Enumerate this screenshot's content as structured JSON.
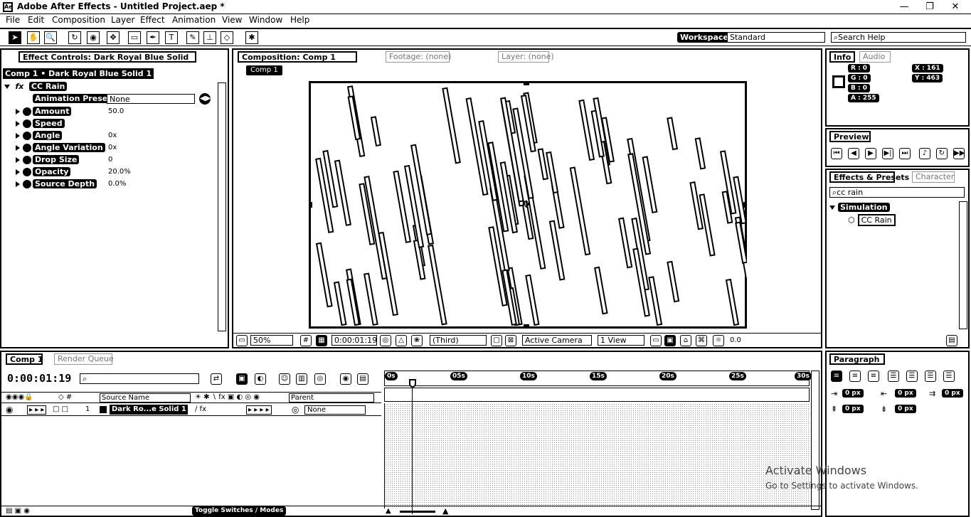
{
  "app": {
    "title": "Adobe After Effects - Untitled Project.aep *",
    "icon_label": "Ae"
  },
  "window_controls": {
    "minimize": "—",
    "maximize": "❐",
    "close": "✕"
  },
  "menu": [
    "File",
    "Edit",
    "Composition",
    "Layer",
    "Effect",
    "Animation",
    "View",
    "Window",
    "Help"
  ],
  "toolbar": {
    "tools": [
      "selection-tool",
      "hand-tool",
      "zoom-tool",
      "rotation-tool",
      "camera-tool",
      "pan-behind-tool",
      "rectangle-mask-tool",
      "pen-tool",
      "text-tool",
      "brush-tool",
      "clone-stamp-tool",
      "eraser-tool",
      "puppet-tool"
    ],
    "workspace_label": "Workspace:",
    "workspace_value": "Standard",
    "search_help_placeholder": "Search Help"
  },
  "effect_controls": {
    "tab_label": "Effect Controls: Dark Royal Blue Solid",
    "layer_path": "Comp 1 • Dark Royal Blue Solid 1",
    "effect_name": "CC Rain",
    "reset_label": "fx",
    "animation_presets_label": "Animation Presets:",
    "animation_presets_value": "None",
    "properties": [
      {
        "name": "Amount",
        "value": "50.0"
      },
      {
        "name": "Speed",
        "value": ""
      },
      {
        "name": "Angle",
        "value": "0x"
      },
      {
        "name": "Angle Variation",
        "value": "0x"
      },
      {
        "name": "Drop Size",
        "value": "0"
      },
      {
        "name": "Opacity",
        "value": "20.0%"
      },
      {
        "name": "Source Depth",
        "value": "0.0%"
      }
    ]
  },
  "composition_panel": {
    "tab_label": "Composition: Comp 1",
    "tab_footage": "Footage: (none)",
    "tab_layer": "Layer: (none)",
    "comp_button": "Comp 1",
    "footer": {
      "zoom": "50%",
      "timecode": "0:00:01:19",
      "resolution": "(Third)",
      "camera": "Active Camera",
      "views": "1 View",
      "exposure": "0.0"
    }
  },
  "info_panel": {
    "tab_label": "Info",
    "tab2_label": "Audio",
    "r": "R : 0",
    "g": "G : 0",
    "b": "B : 0",
    "a": "A : 255",
    "x": "X : 161",
    "y": "Y : 463"
  },
  "preview_panel": {
    "tab_label": "Preview"
  },
  "effects_presets": {
    "tab_label": "Effects & Presets",
    "tab2_label": "Character",
    "search_value": "cc rain",
    "category": "Simulation",
    "item": "CC Rain"
  },
  "timeline": {
    "tab_label": "Comp 1",
    "tab2_label": "Render Queue",
    "timecode": "0:00:01:19",
    "columns": {
      "source_name": "Source Name",
      "parent": "Parent"
    },
    "layer": {
      "number": "1",
      "name": "Dark Ro...e Solid 1",
      "parent": "None"
    },
    "ruler": [
      "0s",
      "05s",
      "10s",
      "15s",
      "20s",
      "25s",
      "30s"
    ],
    "toggle_label": "Toggle Switches / Modes"
  },
  "paragraph_panel": {
    "tab_label": "Paragraph",
    "indents": [
      "0 px",
      "0 px",
      "0 px",
      "0 px",
      "0 px"
    ]
  },
  "watermark": {
    "line1": "Activate Windows",
    "line2": "Go to Settings to activate Windows."
  }
}
